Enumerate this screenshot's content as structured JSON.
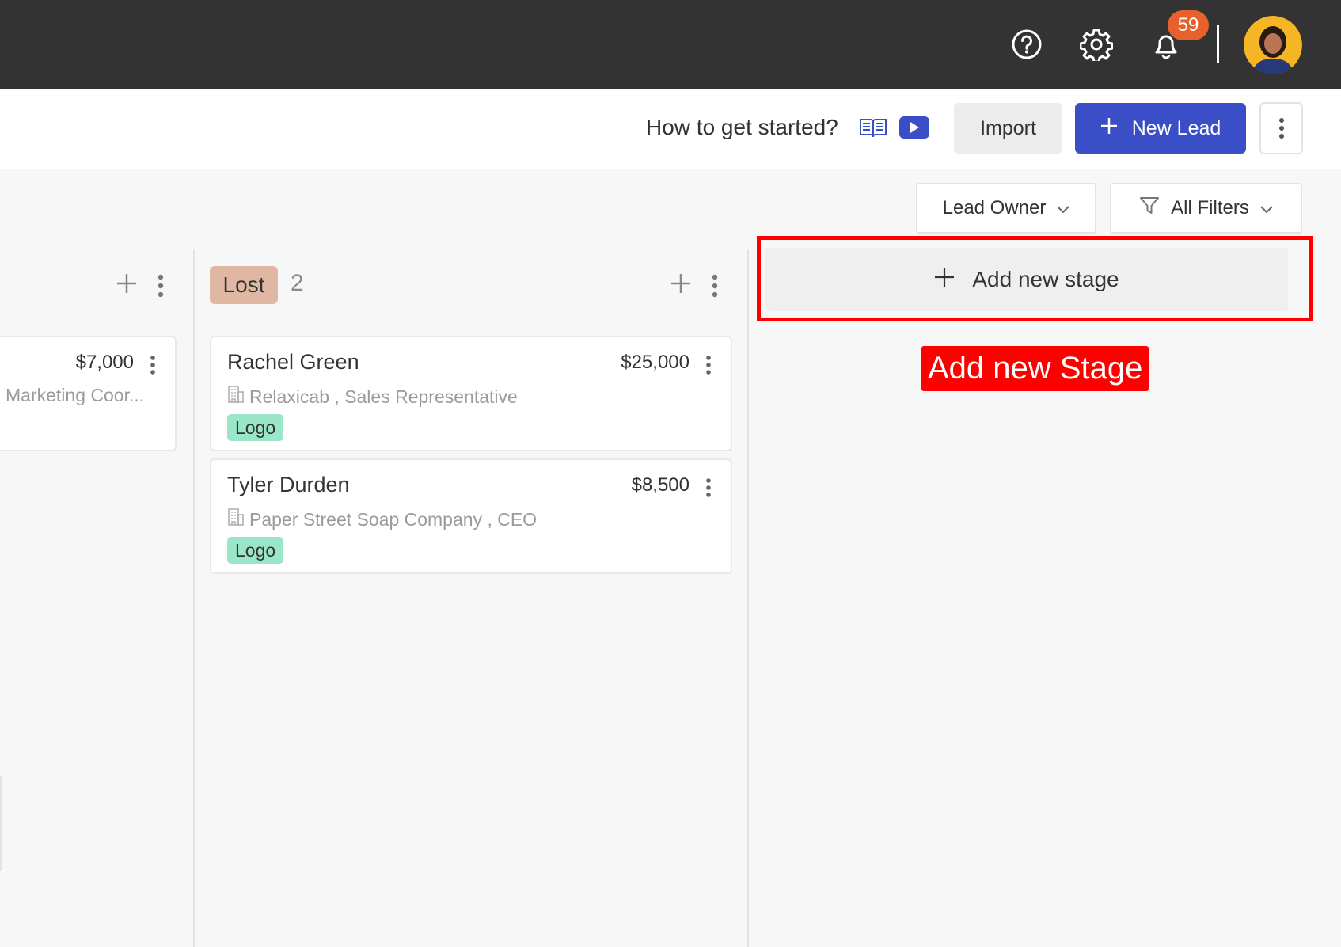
{
  "topbar": {
    "notification_count": "59",
    "icons": [
      "help-icon",
      "gear-icon",
      "bell-icon"
    ]
  },
  "header": {
    "how_to_label": "How to get started?",
    "import_label": "Import",
    "new_lead_label": "New Lead"
  },
  "filters": {
    "lead_owner_label": "Lead Owner",
    "all_filters_label": "All Filters"
  },
  "columns": [
    {
      "stage_name": "",
      "cards": [
        {
          "amount": "$7,000",
          "company": "Marketing Coor..."
        }
      ]
    },
    {
      "stage_name": "Lost",
      "count": "2",
      "stage_color": "#dfb7a3",
      "cards": [
        {
          "name": "Rachel Green",
          "amount": "$25,000",
          "company": "Relaxicab , Sales Representative",
          "tag": "Logo"
        },
        {
          "name": "Tyler Durden",
          "amount": "$8,500",
          "company": "Paper Street Soap Company , CEO",
          "tag": "Logo"
        }
      ]
    }
  ],
  "add_stage": {
    "label": "Add new stage",
    "annotation": "Add new Stage"
  },
  "colors": {
    "topbar": "#333333",
    "primary": "#3a4fc7",
    "badge": "#e8612c",
    "tag": "#99e6c9",
    "annotation": "#ff0000"
  }
}
